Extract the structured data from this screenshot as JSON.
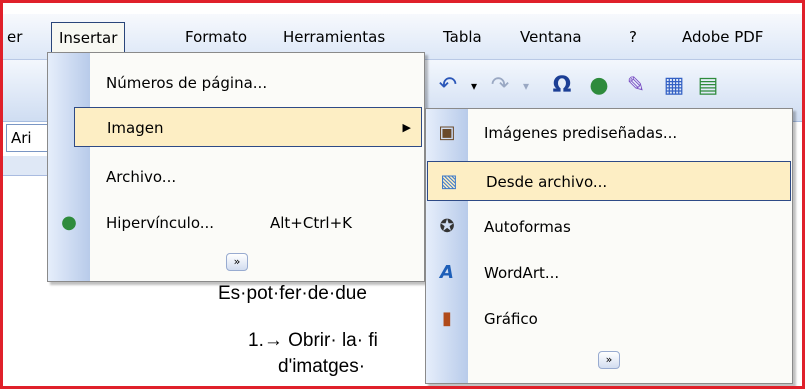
{
  "menubar": {
    "items": [
      {
        "label": "er"
      },
      {
        "label": "Insertar",
        "mnemonic": "I"
      },
      {
        "label": "Formato",
        "mnemonic": "F"
      },
      {
        "label": "Herramientas",
        "mnemonic": "H"
      },
      {
        "label": "Tabla",
        "mnemonic": "l"
      },
      {
        "label": "Ventana",
        "mnemonic": "n"
      },
      {
        "label": "?",
        "mnemonic": "?"
      },
      {
        "label": "Adobe PDF",
        "mnemonic": "b"
      }
    ]
  },
  "toolbar": {
    "font_name": "Ari"
  },
  "insert_menu": {
    "items": [
      {
        "label": "Números de página...",
        "mnemonic": "m"
      },
      {
        "label": "Imagen",
        "mnemonic": "I",
        "submenu": true,
        "highlighted": true
      },
      {
        "label": "Archivo...",
        "mnemonic": "A"
      },
      {
        "label": "Hipervínculo...",
        "mnemonic": "v",
        "shortcut": "Alt+Ctrl+K",
        "icon": "hyperlink-globe-icon"
      }
    ],
    "expand_glyph": "»"
  },
  "image_submenu": {
    "items": [
      {
        "label": "Imágenes prediseñadas...",
        "mnemonic": "I",
        "icon": "clipart-icon"
      },
      {
        "label": "Desde archivo...",
        "mnemonic": "D",
        "icon": "picture-from-file-icon",
        "highlighted": true
      },
      {
        "label": "Autoformas",
        "mnemonic": "A",
        "icon": "autoshapes-icon"
      },
      {
        "label": "WordArt...",
        "mnemonic": "W",
        "icon": "wordart-icon"
      },
      {
        "label": "Gráfico",
        "mnemonic": "G",
        "icon": "chart-icon"
      }
    ],
    "expand_glyph": "»"
  },
  "document": {
    "line1": "Es·pot·fer·de·due",
    "line2": "1.→ Obrir· la· fi",
    "line3": "d'imatges·"
  },
  "colors": {
    "highlight": "#fdeec4",
    "highlight_border": "#2e4a86",
    "frame": "#e0202a"
  }
}
